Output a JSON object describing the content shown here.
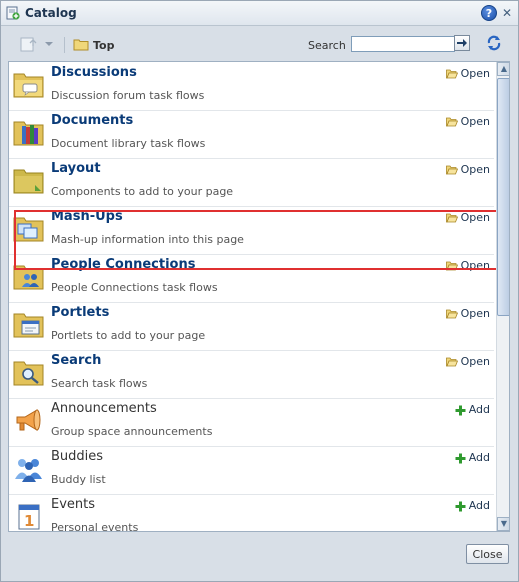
{
  "window": {
    "title": "Catalog"
  },
  "toolbar": {
    "breadcrumb": "Top",
    "search_label": "Search",
    "search_value": ""
  },
  "items": [
    {
      "title": "Discussions",
      "description": "Discussion forum task flows",
      "action": "Open",
      "icon": "folder-discussion-icon",
      "bold": true
    },
    {
      "title": "Documents",
      "description": "Document library task flows",
      "action": "Open",
      "icon": "folder-books-icon",
      "bold": true
    },
    {
      "title": "Layout",
      "description": "Components to add to your page",
      "action": "Open",
      "icon": "folder-layout-icon",
      "bold": true,
      "highlighted": true
    },
    {
      "title": "Mash-Ups",
      "description": "Mash-up information into this page",
      "action": "Open",
      "icon": "folder-mashup-icon",
      "bold": true
    },
    {
      "title": "People Connections",
      "description": "People Connections task flows",
      "action": "Open",
      "icon": "folder-people-icon",
      "bold": true
    },
    {
      "title": "Portlets",
      "description": "Portlets to add to your page",
      "action": "Open",
      "icon": "folder-portlet-icon",
      "bold": true
    },
    {
      "title": "Search",
      "description": "Search task flows",
      "action": "Open",
      "icon": "folder-search-icon",
      "bold": true
    },
    {
      "title": "Announcements",
      "description": "Group space announcements",
      "action": "Add",
      "icon": "megaphone-icon",
      "bold": false
    },
    {
      "title": "Buddies",
      "description": "Buddy list",
      "action": "Add",
      "icon": "buddies-icon",
      "bold": false
    },
    {
      "title": "Events",
      "description": "Personal events",
      "action": "Add",
      "icon": "calendar-icon",
      "bold": false
    }
  ],
  "footer": {
    "close_label": "Close"
  },
  "colors": {
    "highlight": "#e03030",
    "title_text": "#0a3b78",
    "add_green": "#2f9a2f"
  }
}
